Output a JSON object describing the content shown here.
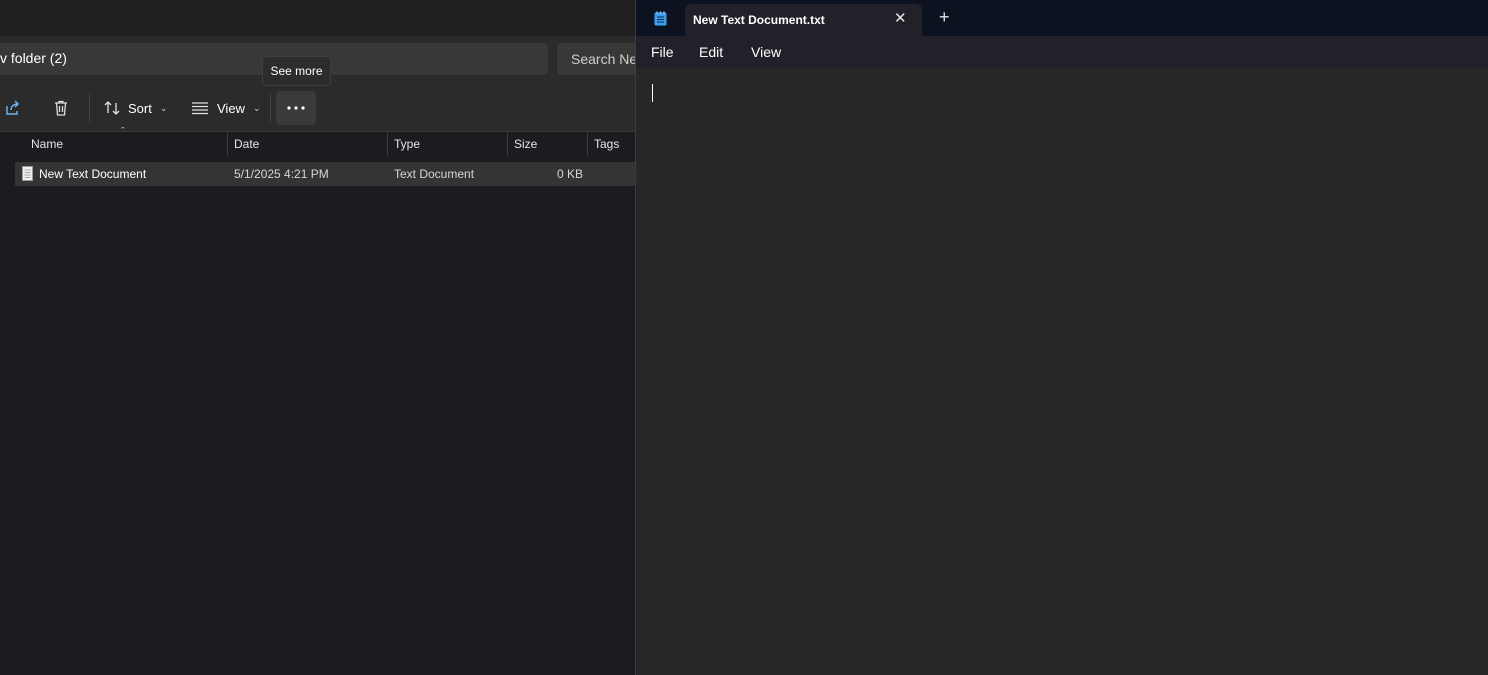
{
  "explorer": {
    "address": "v folder (2)",
    "search_placeholder": "Search Ne",
    "toolbar": {
      "share_icon": "share-icon",
      "delete_icon": "trash-icon",
      "sort_label": "Sort",
      "view_label": "View",
      "more_icon": "more-horizontal-icon"
    },
    "tooltip": "See more",
    "columns": [
      "Name",
      "Date",
      "Type",
      "Size",
      "Tags"
    ],
    "files": [
      {
        "name": "New Text Document",
        "date": "5/1/2025 4:21 PM",
        "type": "Text Document",
        "size": "0 KB"
      }
    ]
  },
  "notepad": {
    "tab_title": "New Text Document.txt",
    "menu": [
      "File",
      "Edit",
      "View"
    ],
    "content": ""
  },
  "colors": {
    "notepad_accent": "#3b9ff0",
    "background": "#1c1b1f"
  }
}
